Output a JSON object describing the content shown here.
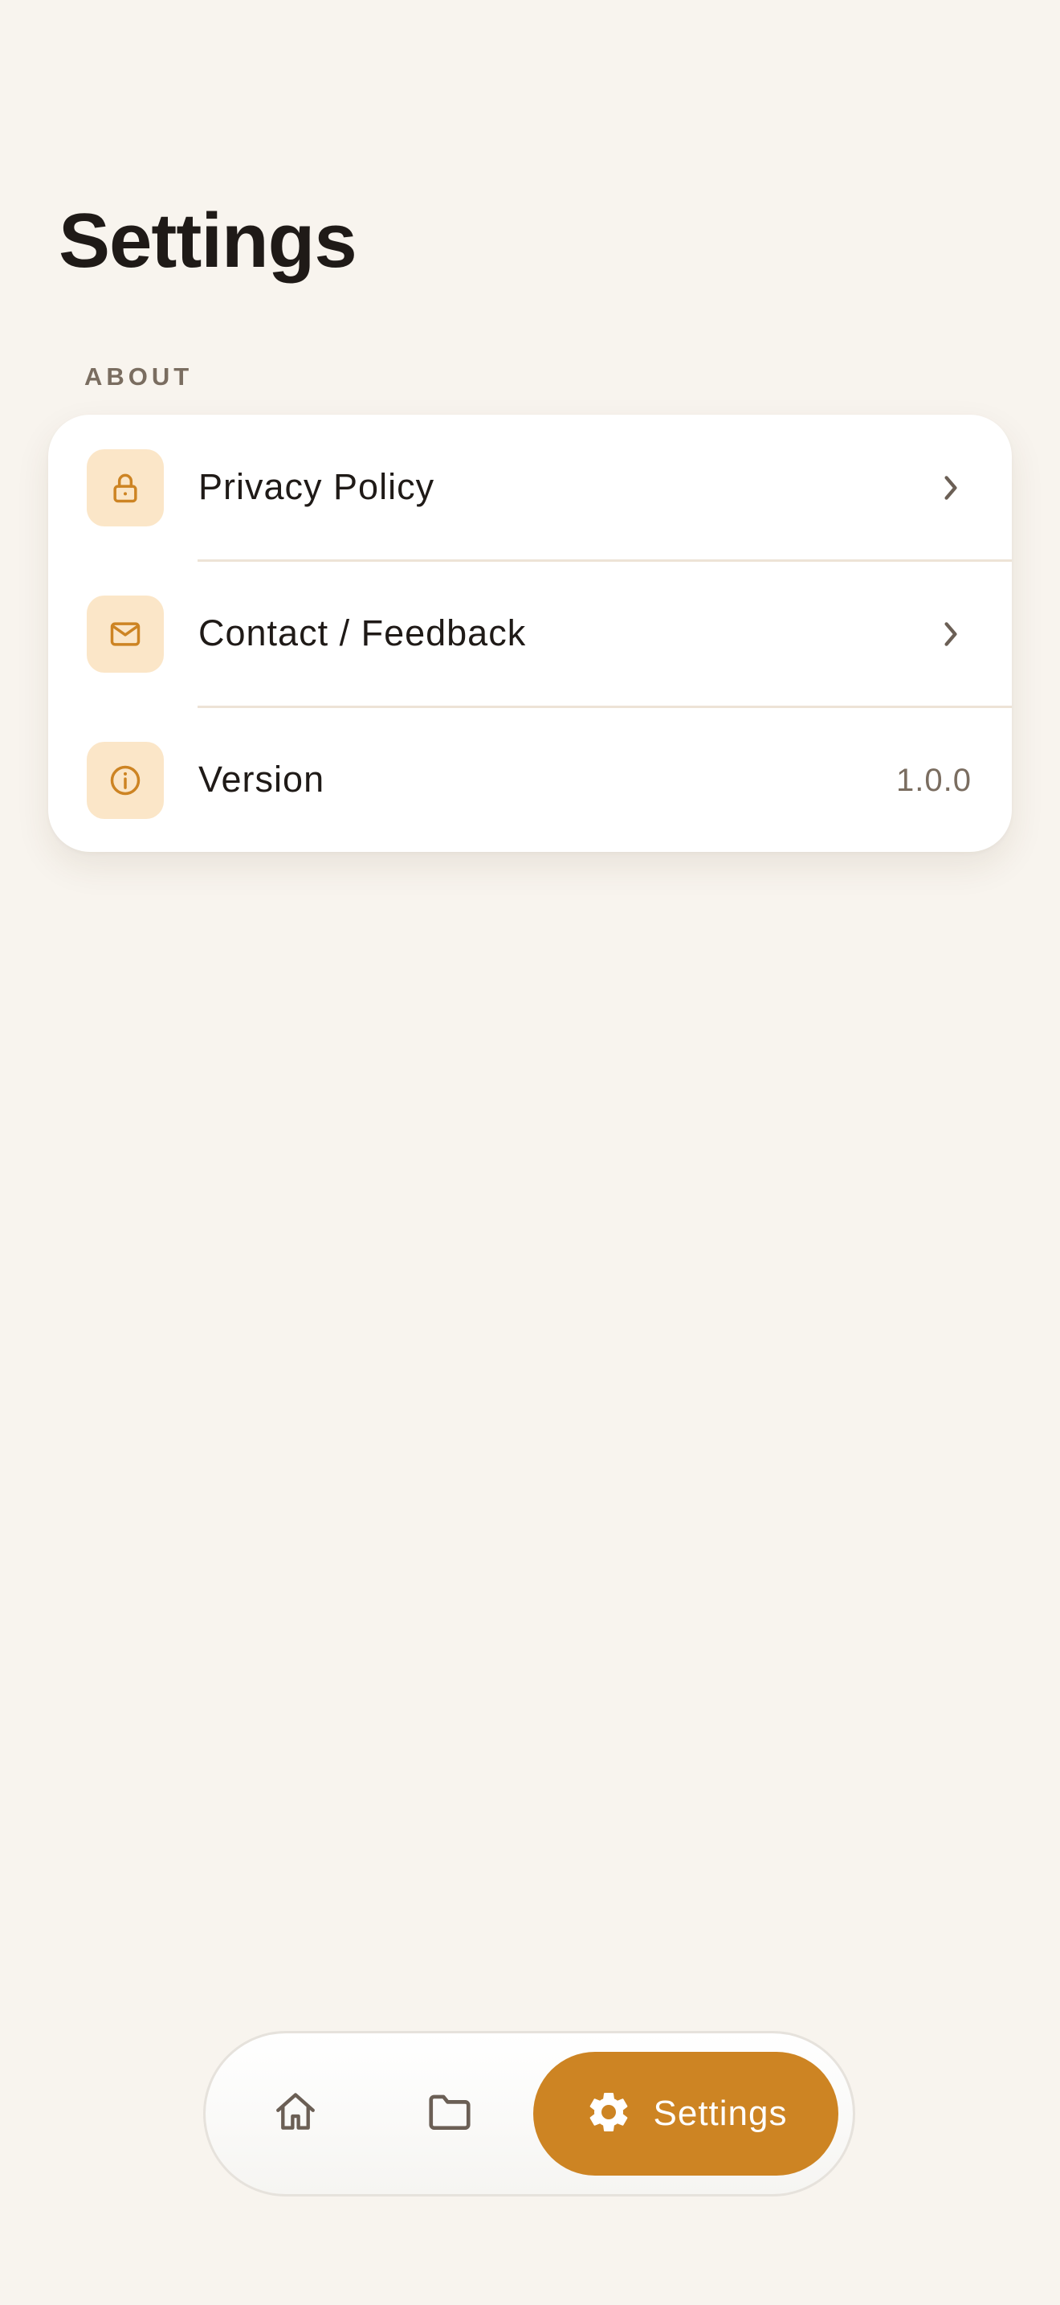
{
  "header": {
    "title": "Settings"
  },
  "sections": [
    {
      "header": "ABOUT",
      "items": [
        {
          "label": "Privacy Policy",
          "icon": "lock-icon",
          "trailing": "chevron-right-icon"
        },
        {
          "label": "Contact / Feedback",
          "icon": "mail-icon",
          "trailing": "chevron-right-icon"
        },
        {
          "label": "Version",
          "icon": "info-icon",
          "value": "1.0.0"
        }
      ]
    }
  ],
  "tab_bar": {
    "tabs": [
      {
        "icon": "home-icon",
        "selected": false
      },
      {
        "icon": "folder-icon",
        "selected": false
      },
      {
        "icon": "gear-icon",
        "label": "Settings",
        "selected": true
      }
    ]
  },
  "colors": {
    "background": "#f8f4ee",
    "accent": "#cd8423",
    "icon_tile": "#fbe6c8",
    "text_primary": "#1f1a17",
    "text_secondary": "#7a6d60"
  }
}
